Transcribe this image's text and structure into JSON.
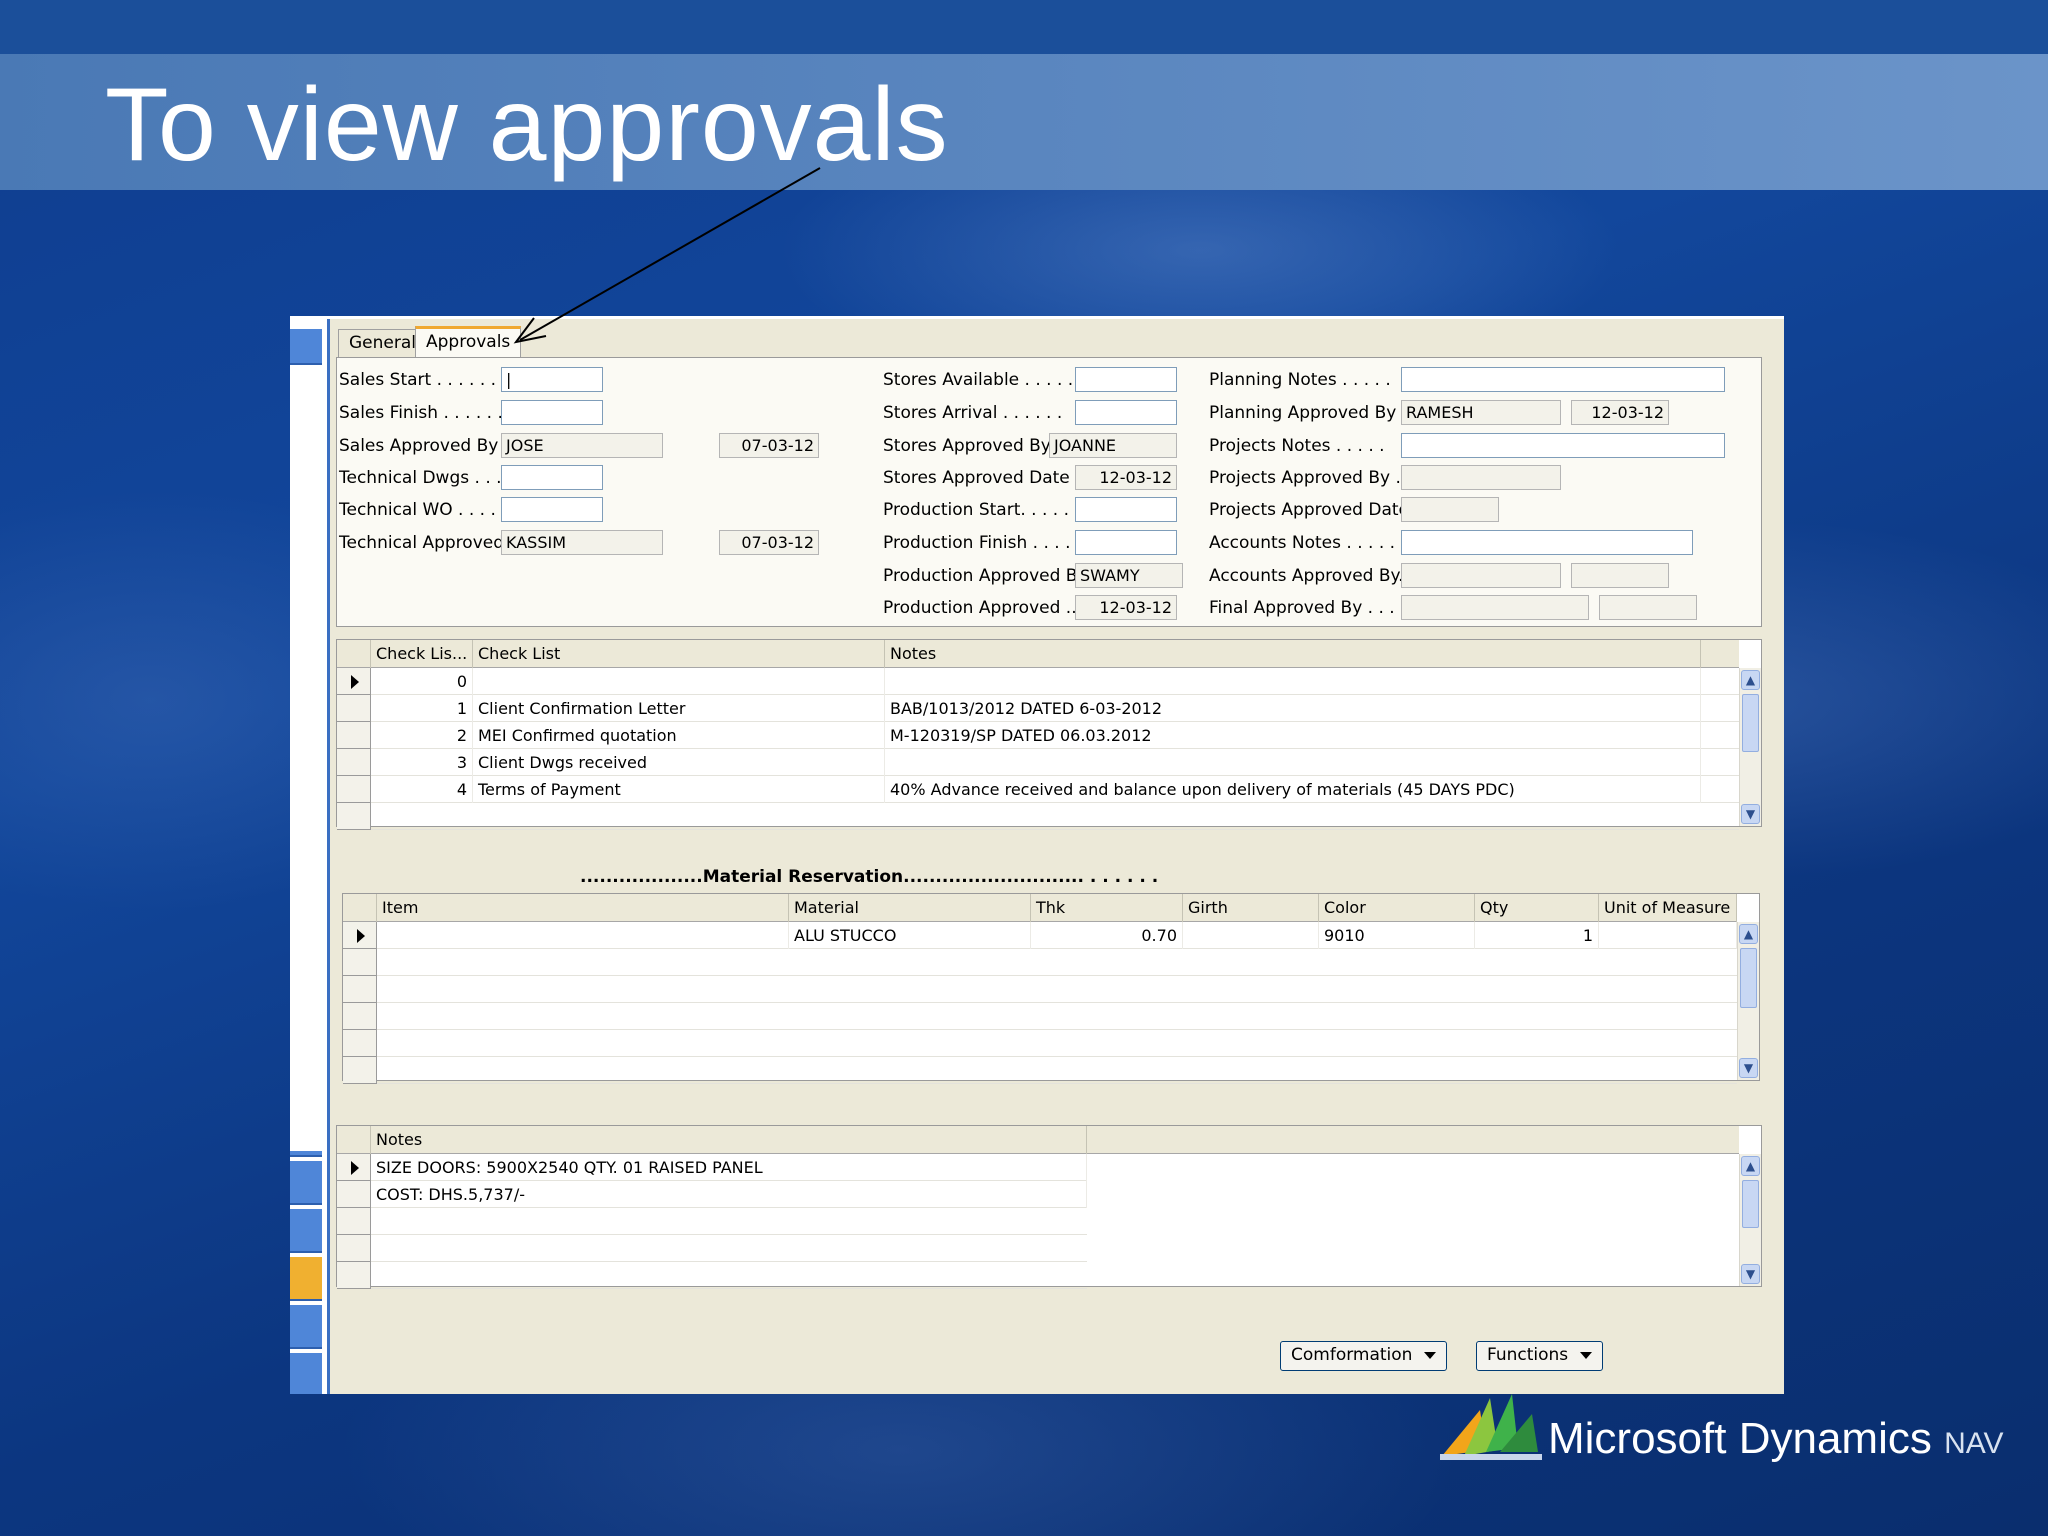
{
  "slide": {
    "title": "To view approvals",
    "brand": {
      "name": "Microsoft Dynamics",
      "suffix": "NAV"
    }
  },
  "tabs": [
    {
      "label": "General",
      "active": false
    },
    {
      "label": "Approvals",
      "active": true
    }
  ],
  "approvals": {
    "sales_start": {
      "label": "Sales Start . . . . . . . .",
      "value": "|"
    },
    "sales_finish": {
      "label": "Sales Finish . . . . . . . .",
      "value": ""
    },
    "sales_approved_by": {
      "label": "Sales Approved By . . . .",
      "value": "JOSE",
      "date": "07-03-12"
    },
    "technical_dwgs": {
      "label": "Technical Dwgs . . . . . .",
      "value": ""
    },
    "technical_wo": {
      "label": "Technical WO . . . . . . .",
      "value": ""
    },
    "technical_approved_by": {
      "label": "Technical Approved By. .",
      "value": "KASSIM",
      "date": "07-03-12"
    },
    "stores_available": {
      "label": "Stores Available . . . . .",
      "value": ""
    },
    "stores_arrival": {
      "label": "Stores Arrival . . . . . .",
      "value": ""
    },
    "stores_approved_by": {
      "label": "Stores Approved By .",
      "value": "JOANNE"
    },
    "stores_approved_date": {
      "label": "Stores Approved Date . .",
      "value": "12-03-12"
    },
    "production_start": {
      "label": "Production Start. . . . .",
      "value": ""
    },
    "production_finish": {
      "label": "Production Finish . . . .",
      "value": ""
    },
    "production_approved_by": {
      "label": "Production Approved By .",
      "value": "SWAMY"
    },
    "production_approved": {
      "label": "Production Approved ...",
      "value": "12-03-12"
    },
    "planning_notes": {
      "label": "Planning Notes . . . . .",
      "value": ""
    },
    "planning_approved_by": {
      "label": "Planning Approved By . .",
      "value": "RAMESH",
      "date": "12-03-12"
    },
    "projects_notes": {
      "label": "Projects Notes . . . . .",
      "value": ""
    },
    "projects_approved_by": {
      "label": "Projects Approved By . .",
      "value": ""
    },
    "projects_approved_date": {
      "label": "Projects Approved Date .",
      "value": ""
    },
    "accounts_notes": {
      "label": "Accounts Notes . . . . .",
      "value": ""
    },
    "accounts_approved_by": {
      "label": "Accounts Approved By. .",
      "value": "",
      "date": ""
    },
    "final_approved_by": {
      "label": "Final Approved By . . . .",
      "value": "",
      "date": ""
    }
  },
  "checklist": {
    "columns": [
      "Check Lis...",
      "Check List",
      "Notes"
    ],
    "rows": [
      {
        "no": "0",
        "item": "",
        "notes": ""
      },
      {
        "no": "1",
        "item": "Client Confirmation Letter",
        "notes": "BAB/1013/2012 DATED 6-03-2012"
      },
      {
        "no": "2",
        "item": "MEI Confirmed quotation",
        "notes": "M-120319/SP DATED 06.03.2012"
      },
      {
        "no": "3",
        "item": "Client Dwgs received",
        "notes": ""
      },
      {
        "no": "4",
        "item": "Terms of Payment",
        "notes": "40% Advance received and balance upon delivery of materials (45 DAYS PDC)"
      }
    ]
  },
  "material": {
    "section_title": "...................Material Reservation............................ . . . . . .",
    "columns": [
      "Item",
      "Material",
      "Thk",
      "Girth",
      "Color",
      "Qty",
      "Unit of Measure"
    ],
    "rows": [
      {
        "item": "",
        "material": "ALU STUCCO",
        "thk": "0.70",
        "girth": "",
        "color": "9010",
        "qty": "1",
        "uom": ""
      }
    ]
  },
  "notes": {
    "column": "Notes",
    "rows": [
      "SIZE DOORS: 5900X2540 QTY. 01 RAISED PANEL",
      "COST: DHS.5,737/-"
    ]
  },
  "buttons": {
    "conformation": "Comformation",
    "functions": "Functions"
  }
}
